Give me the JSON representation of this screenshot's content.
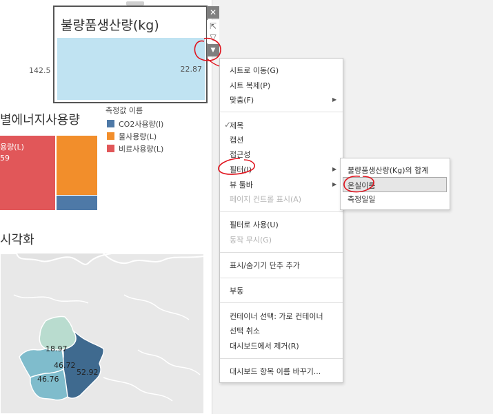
{
  "sheet": {
    "title": "불량품생산량(kg)",
    "bar_value": "22.87",
    "side_value": "142.5",
    "controls": {
      "close_icon": "✕",
      "popout_icon": "⇱",
      "filter_icon": "▽",
      "dropdown_icon": "▼"
    }
  },
  "treemap": {
    "title": "별에너지사용량",
    "cell_label": "용량(L)",
    "cell_value": "59",
    "legend_title": "측정값 이름",
    "legend": [
      {
        "label": "CO2사용량(l)",
        "color": "#4e79a7"
      },
      {
        "label": "물사용량(L)",
        "color": "#f28e2b"
      },
      {
        "label": "비료사용량(L)",
        "color": "#e15759"
      }
    ]
  },
  "map": {
    "title": "시각화",
    "values": [
      "18.97",
      "46.72",
      "52.92",
      "46.76"
    ]
  },
  "context_menu": {
    "items": {
      "move_to_sheet": "시트로 이동(G)",
      "duplicate_sheet": "시트 복제(P)",
      "fit": "맞춤(F)",
      "title": "제목",
      "caption": "캡션",
      "accessibility": "접근성",
      "filter": "필터(I)",
      "view_toolbar": "뷰 툴바",
      "page_controls": "페이지 컨트롤 표시(A)",
      "use_as_filter": "필터로 사용(U)",
      "ignore_actions": "동작 무시(G)",
      "add_show_hide": "표시/숨기기 단추 추가",
      "floating": "부동",
      "select_container": "컨테이너 선택: 가로 컨테이너",
      "deselect": "선택 취소",
      "remove_from_dashboard": "대시보드에서 제거(R)",
      "rename_item": "대시보드 항목 이름 바꾸기..."
    },
    "check_mark": "✓",
    "submenu_arrow": "▶"
  },
  "filter_submenu": {
    "items": [
      "불량품생산량(Kg)의 합계",
      "온실이름",
      "측정일일"
    ],
    "highlighted_index": 1
  },
  "colors": {
    "bar": "#c0e3f2",
    "annotation": "#e0141e",
    "map_dark": "#3f6a8f",
    "map_mid": "#7fbccc",
    "map_light": "#b9dccf"
  }
}
